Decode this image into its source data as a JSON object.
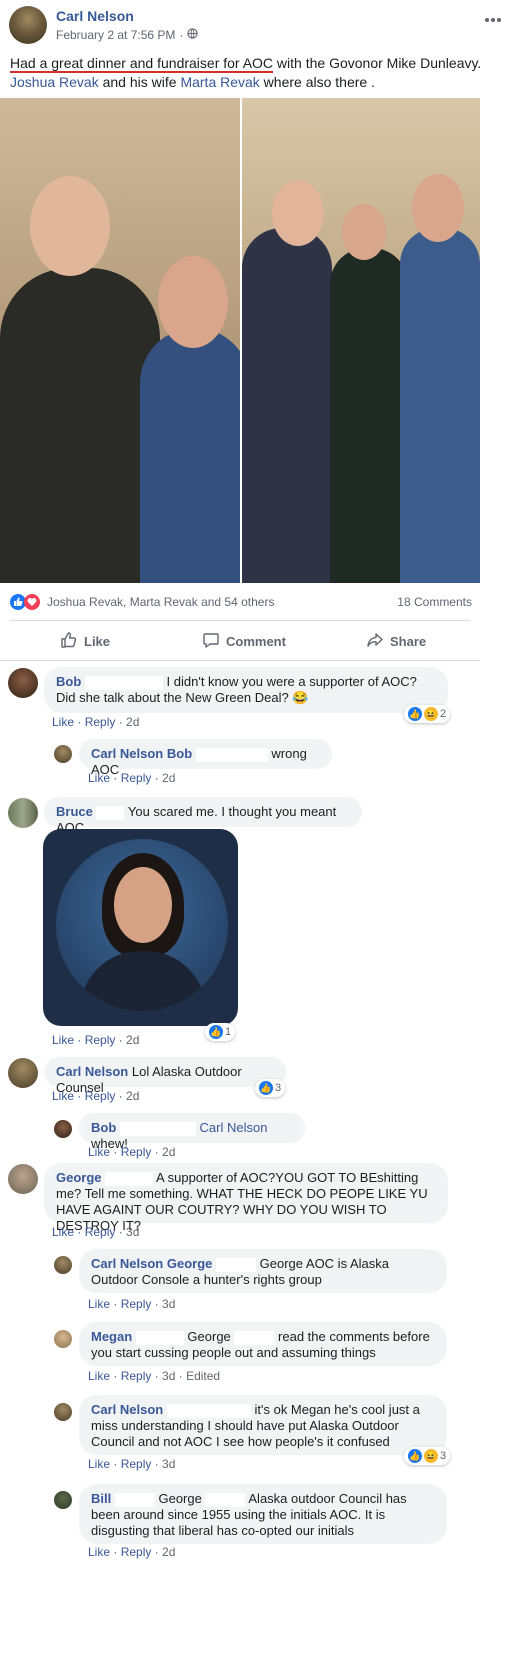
{
  "post": {
    "author": "Carl Nelson",
    "date": "February 2 at 7:56 PM",
    "separator": "·",
    "text_underlined": "Had a great dinner and fundraiser for AOC",
    "text_1": " with the Govonor Mike Dunleavy.",
    "tag_1": "Joshua Revak",
    "text_2": " and his wife ",
    "tag_2": "Marta Revak",
    "text_3": " where also there ."
  },
  "reactions": {
    "summary": "Joshua Revak, Marta Revak and 54 others",
    "comments_count": "18 Comments"
  },
  "action_bar": {
    "like": "Like",
    "comment": "Comment",
    "share": "Share"
  },
  "comments": [
    {
      "name": "Bob",
      "text": "I didn't know you were a supporter of AOC? Did she talk about the New Green Deal? 😂",
      "like": "Like",
      "reply": "Reply",
      "time": "2d",
      "reaction_count": "2"
    },
    {
      "name": "Carl Nelson",
      "mention": "Bob",
      "text": "wrong AOC",
      "like": "Like",
      "reply": "Reply",
      "time": "2d"
    },
    {
      "name": "Bruce",
      "text": "You scared me. I thought you meant AOC",
      "like": "Like",
      "reply": "Reply",
      "time": "2d",
      "reaction_count": "1"
    },
    {
      "name": "Carl Nelson",
      "text": "Lol Alaska Outdoor Counsel",
      "like": "Like",
      "reply": "Reply",
      "time": "2d",
      "reaction_count": "3"
    },
    {
      "name": "Bob",
      "mention": "Carl Nelson",
      "text": "whew!",
      "like": "Like",
      "reply": "Reply",
      "time": "2d"
    },
    {
      "name": "George",
      "text": "A supporter of AOC?YOU GOT TO BEshitting me? Tell me something. WHAT THE HECK DO PEOPE LIKE YU HAVE AGAINT OUR COUTRY? WHY DO YOU WISH TO DESTROY IT?",
      "like": "Like",
      "reply": "Reply",
      "time": "3d"
    },
    {
      "name": "Carl Nelson",
      "mention": "George",
      "text": "George AOC is Alaska Outdoor Console a hunter's rights group",
      "like": "Like",
      "reply": "Reply",
      "time": "3d"
    },
    {
      "name": "Megan",
      "mention": "George",
      "text": "read the comments before you start cussing people out and assuming things",
      "like": "Like",
      "reply": "Reply",
      "time": "3d",
      "edited": "Edited"
    },
    {
      "name": "Carl Nelson",
      "text": "it's ok Megan he's cool just a miss understanding I should have put Alaska Outdoor Council and not AOC I see how people's it confused",
      "like": "Like",
      "reply": "Reply",
      "time": "3d",
      "reaction_count": "3"
    },
    {
      "name": "Bill",
      "mention": "George",
      "text": "Alaska outdoor Council has been around since 1955 using the initials AOC. It is disgusting that liberal has co-opted our initials",
      "like": "Like",
      "reply": "Reply",
      "time": "2d"
    }
  ],
  "icons": {
    "more": "more-options-icon",
    "globe": "globe-icon",
    "like": "thumbs-up-icon",
    "comment": "comment-icon",
    "share": "share-icon"
  },
  "colors": {
    "link": "#385898",
    "accent": "#1877f2",
    "underline": "#d32f2f",
    "bubble": "#f2f3f5"
  }
}
